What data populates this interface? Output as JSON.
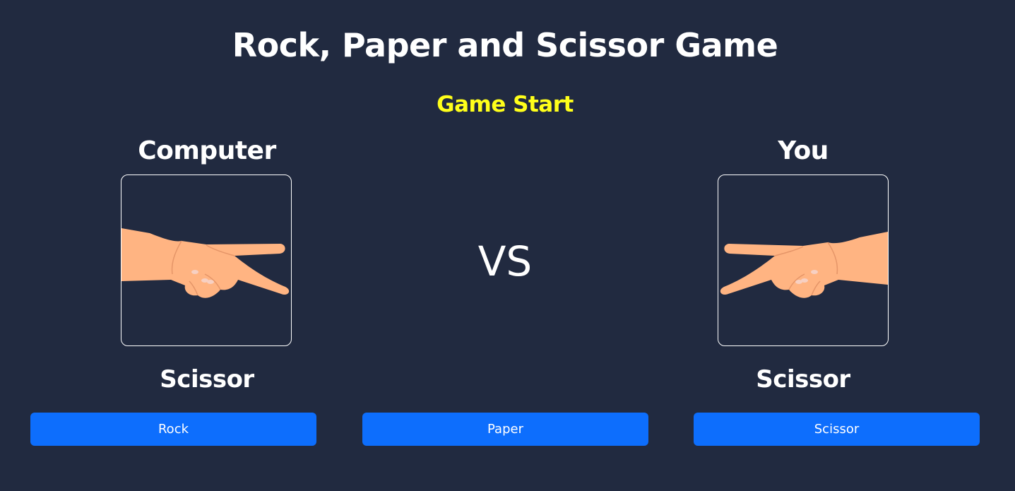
{
  "title": "Rock, Paper and Scissor Game",
  "status": {
    "text": "Game Start",
    "color": "#ffff1a"
  },
  "computer": {
    "label": "Computer",
    "choice": "Scissor",
    "hand_icon": "scissor-hand-icon"
  },
  "vs_text": "VS",
  "player": {
    "label": "You",
    "choice": "Scissor",
    "hand_icon": "scissor-hand-icon"
  },
  "buttons": {
    "rock": "Rock",
    "paper": "Paper",
    "scissor": "Scissor"
  },
  "colors": {
    "background": "#212a40",
    "button": "#0d6efd",
    "skin": "#ffb482",
    "text": "#ffffff"
  }
}
